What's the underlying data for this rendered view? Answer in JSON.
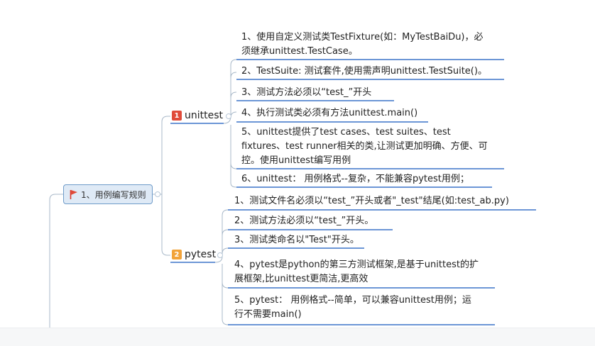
{
  "root": {
    "label": "1、用例编写规则"
  },
  "branches": [
    {
      "badge": "1",
      "label": "unittest",
      "items": [
        [
          "1、使用自定义测试类TestFixture(如：MyTestBaiDu)，必",
          "须继承unittest.TestCase。"
        ],
        [
          "2、TestSuite: 测试套件,使用需声明unittest.TestSuite()。"
        ],
        [
          "3、测试方法必须以“test_”开头"
        ],
        [
          "4、执行测试类必须有方法unittest.main()"
        ],
        [
          "5、unittest提供了test cases、test suites、test",
          "fixtures、test runner相关的类,让测试更加明确、方便、可",
          "控。使用unittest编写用例"
        ],
        [
          "6、unittest： 用例格式--复杂，不能兼容pytest用例；"
        ]
      ]
    },
    {
      "badge": "2",
      "label": "pytest",
      "items": [
        [
          "1、测试文件名必须以“test_”开头或者\"_test\"结尾(如:test_ab.py)"
        ],
        [
          "2、测试方法必须以“test_”开头。"
        ],
        [
          "3、测试类命名以\"Test\"开头。"
        ],
        [
          "4、pytest是python的第三方测试框架,是基于unittest的扩",
          "展框架,比unittest更简洁,更高效"
        ],
        [
          "5、pytest：   用例格式--简单，可以兼容unittest用例；运",
          "行不需要main()"
        ]
      ]
    }
  ],
  "colors": {
    "line": "#3b74c8",
    "connector": "#a8b8c8",
    "badge1": "#e04b3a",
    "badge2": "#f2a33a"
  }
}
